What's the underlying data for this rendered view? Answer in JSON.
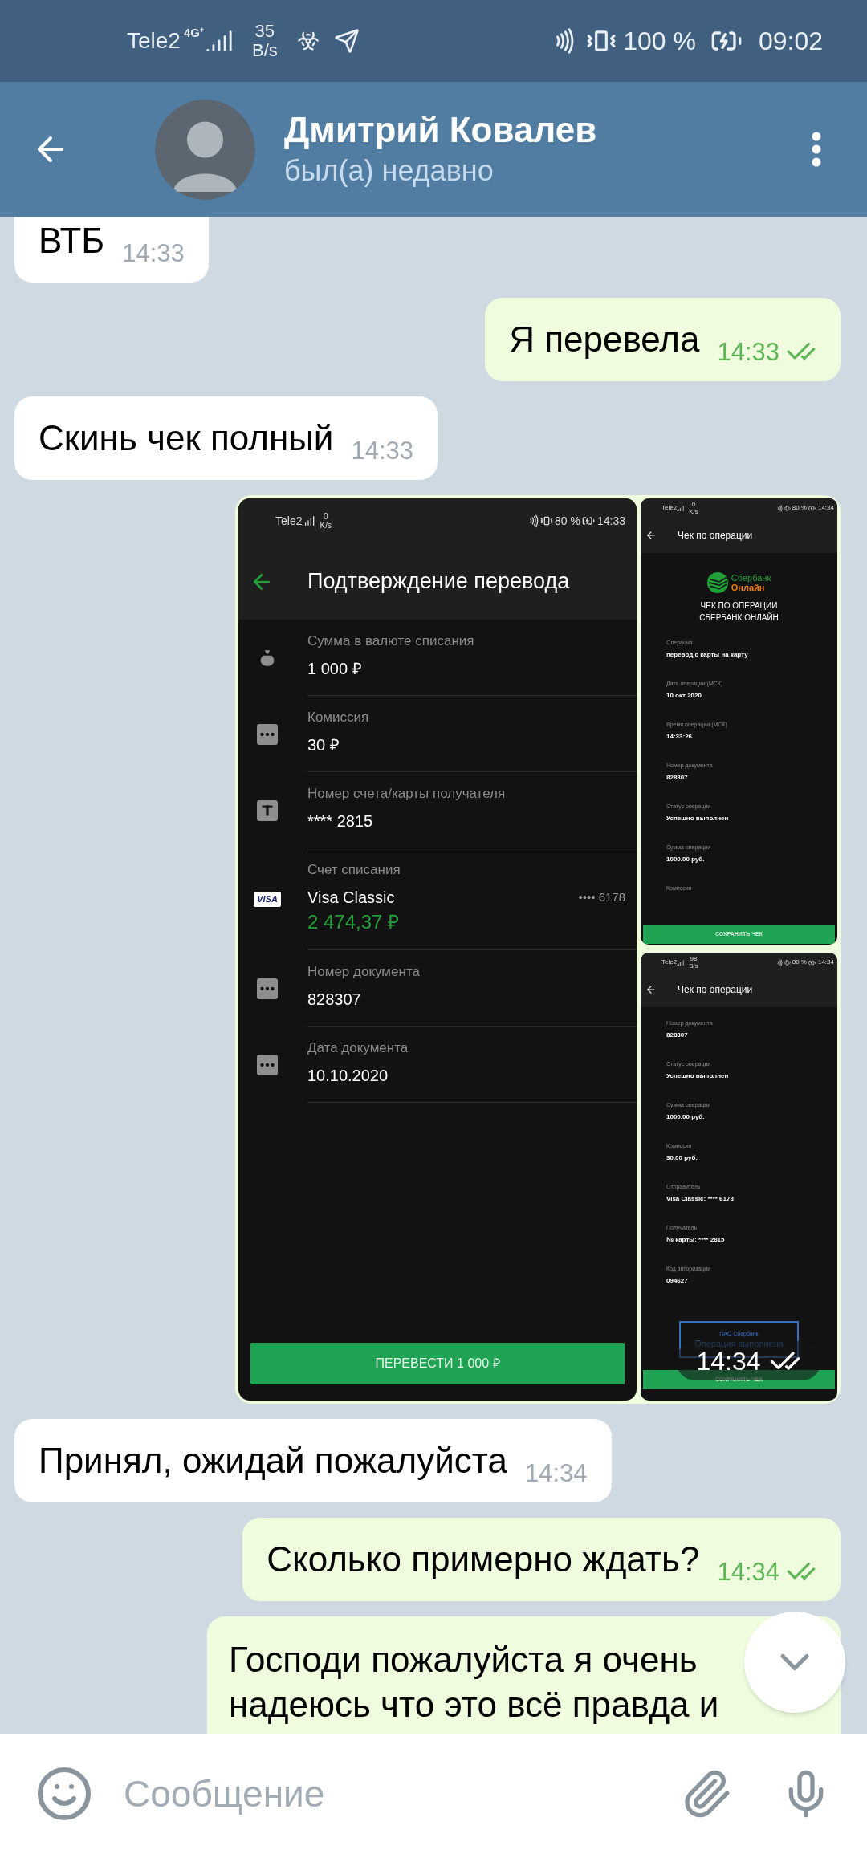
{
  "status_bar": {
    "carrier": "Tele2",
    "network": "4G⁺",
    "speed": "35",
    "speed_unit": "B/s",
    "battery": "100 %",
    "time": "09:02"
  },
  "header": {
    "name": "Дмитрий Ковалев",
    "status": "был(а) недавно"
  },
  "messages": [
    {
      "kind": "text",
      "outgoing": false,
      "text": "ВТБ",
      "time": "14:33"
    },
    {
      "kind": "text",
      "outgoing": true,
      "read": true,
      "text": "Я перевела",
      "time": "14:33"
    },
    {
      "kind": "text",
      "outgoing": false,
      "text": "Скинь чек полный",
      "time": "14:33"
    },
    {
      "kind": "album",
      "outgoing": true,
      "read": true,
      "time": "14:34",
      "screens": [
        {
          "kind": "confirmation",
          "status_bar": {
            "carrier": "Tele2",
            "speed": "0",
            "speed_unit": "K/s",
            "battery": "80 %",
            "time": "14:33"
          },
          "title": "Подтверждение перевода",
          "rows": [
            {
              "kind": "bag",
              "label": "Сумма в валюте списания",
              "value": "1 000 ₽"
            },
            {
              "kind": "dots",
              "label": "Комиссия",
              "value": "30 ₽"
            },
            {
              "kind": "letter",
              "label": "Номер счета/карты получателя",
              "value": "**** 2815"
            },
            {
              "kind": "card",
              "card_brand": "VISA",
              "label": "Счет списания",
              "value": "Visa Classic",
              "card_mask": "•••• 6178",
              "balance": "2 474,37 ₽"
            },
            {
              "kind": "dots",
              "label": "Номер документа",
              "value": "828307"
            },
            {
              "kind": "dots",
              "label": "Дата документа",
              "value": "10.10.2020"
            }
          ],
          "button": "ПЕРЕВЕСТИ 1 000 ₽"
        },
        {
          "kind": "receipt",
          "status_bar": {
            "carrier": "Tele2",
            "speed": "0",
            "speed_unit": "K/s",
            "battery": "80 %",
            "time": "14:34"
          },
          "title": "Чек по операции",
          "logo": {
            "line1": "Сбербанк",
            "line2": "Онлайн"
          },
          "heading": [
            "ЧЕК ПО ОПЕРАЦИИ",
            "СБЕРБАНК ОНЛАЙН"
          ],
          "fields": [
            {
              "label": "Операция",
              "value": "перевод с карты на карту"
            },
            {
              "label": "Дата операции (МСК)",
              "value": "10 окт 2020"
            },
            {
              "label": "Время операции (МСК)",
              "value": "14:33:26"
            },
            {
              "label": "Номер документа",
              "value": "828307"
            },
            {
              "label": "Статус операции",
              "value": "Успешно выполнен"
            },
            {
              "label": "Сумма операции",
              "value": "1000.00 руб."
            },
            {
              "label": "Комиссия"
            }
          ],
          "button": "СОХРАНИТЬ ЧЕК"
        },
        {
          "kind": "receipt",
          "status_bar": {
            "carrier": "Tele2",
            "speed": "98",
            "speed_unit": "B/s",
            "battery": "80 %",
            "time": "14:34"
          },
          "title": "Чек по операции",
          "fields": [
            {
              "label": "Номер документа",
              "value": "828307"
            },
            {
              "label": "Статус операции",
              "value": "Успешно выполнен"
            },
            {
              "label": "Сумма операции",
              "value": "1000.00 руб."
            },
            {
              "label": "Комиссия",
              "value": "30.00 руб."
            },
            {
              "label": "Отправитель",
              "value": "Visa Classic: **** 6178"
            },
            {
              "label": "Получатель",
              "value": "№ карты: **** 2815"
            },
            {
              "label": "Код авторизации",
              "value": "094627"
            }
          ],
          "stamp": {
            "issuer": "ПАО Сбербанк",
            "text": "Операция выполнена"
          },
          "button": "СОХРАНИТЬ ЧЕК"
        }
      ]
    },
    {
      "kind": "text",
      "outgoing": false,
      "text": "Принял, ожидай пожалуйста",
      "time": "14:34"
    },
    {
      "kind": "text",
      "outgoing": true,
      "read": true,
      "text": "Сколько примерно ждать?",
      "time": "14:34"
    },
    {
      "kind": "cut",
      "outgoing": true,
      "lines": [
        "Господи пожалуйста я очень",
        "надеюсь что это всё правда и"
      ]
    }
  ],
  "composer": {
    "placeholder": "Сообщение"
  }
}
